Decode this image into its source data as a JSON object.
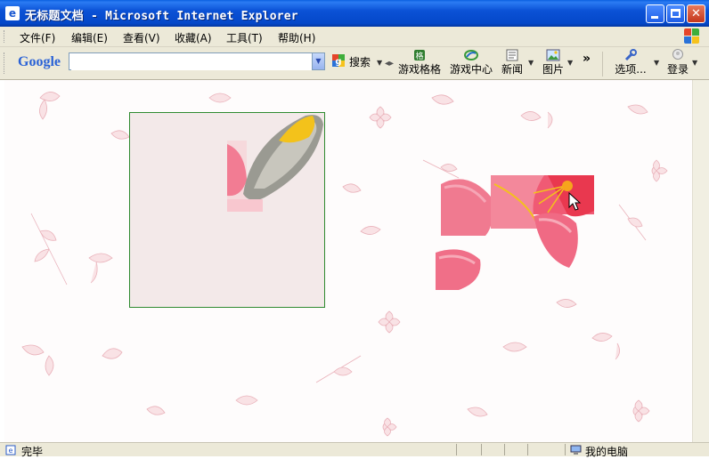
{
  "window": {
    "title": "无标题文档 - Microsoft Internet Explorer"
  },
  "menu": {
    "items": [
      "文件(F)",
      "编辑(E)",
      "查看(V)",
      "收藏(A)",
      "工具(T)",
      "帮助(H)"
    ]
  },
  "toolbar": {
    "google_logo": "Google",
    "search_value": "",
    "search_button": "搜索",
    "game_grid": "游戏格格",
    "game_center": "游戏中心",
    "news": "新闻",
    "images": "图片",
    "more": "»",
    "options": "选项...",
    "login": "登录"
  },
  "status": {
    "text": "完毕",
    "zone": "我的电脑"
  },
  "colors": {
    "board_border": "#2f8a2f",
    "board_fill": "#f3e9e9",
    "petal_pink": "#f0708a",
    "stamen_yellow": "#f3c21b"
  }
}
